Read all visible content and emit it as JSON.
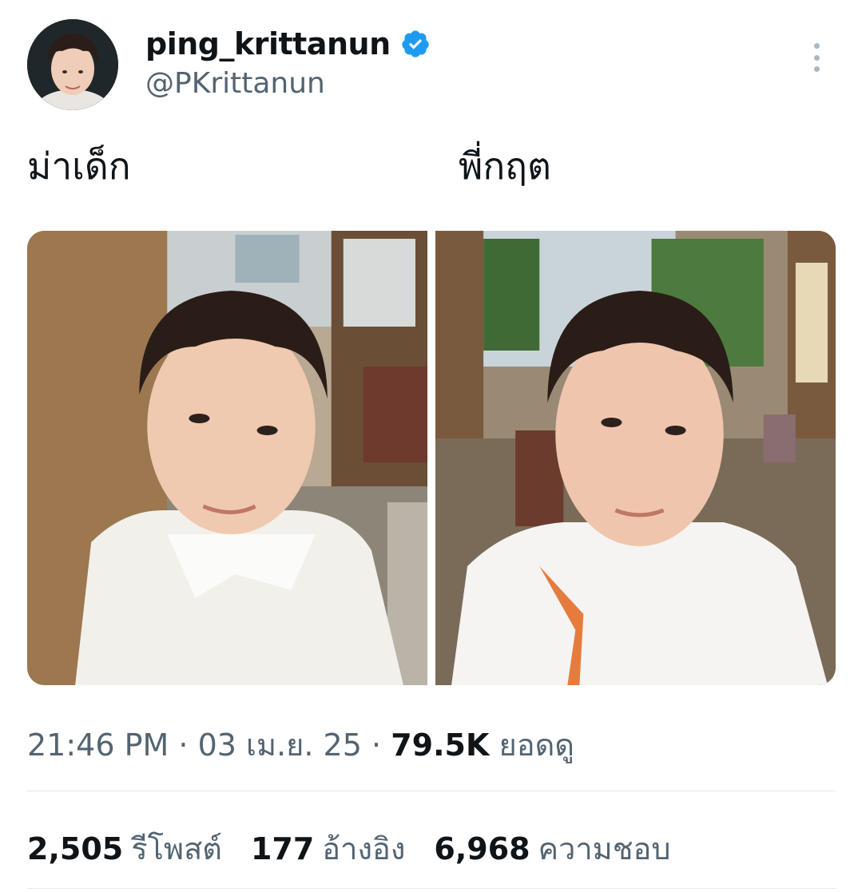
{
  "author": {
    "display_name": "ping_krittanun",
    "handle": "@PKrittanun",
    "verified_color": "#1d9bf0"
  },
  "tweet": {
    "caption_left": "ม่าเด็ก",
    "caption_right": "พี่กฤต"
  },
  "meta": {
    "time": "21:46 PM",
    "separator": "·",
    "date": "03 เม.ย. 25",
    "views_count": "79.5K",
    "views_label": "ยอดดู"
  },
  "stats": {
    "reposts_count": "2,505",
    "reposts_label": "รีโพสต์",
    "quotes_count": "177",
    "quotes_label": "อ้างอิง",
    "likes_count": "6,968",
    "likes_label": "ความชอบ"
  },
  "icons": {
    "more": "more-vertical-icon",
    "verified": "verified-badge-icon"
  }
}
